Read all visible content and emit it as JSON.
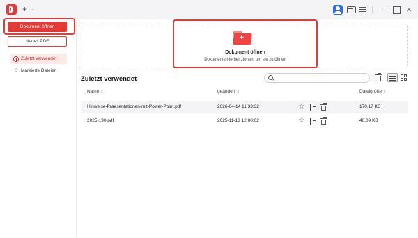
{
  "titlebar": {
    "new_tab_symbol": "+",
    "chevron_symbol": "⌄",
    "close_symbol": "×"
  },
  "sidebar": {
    "open_button": "Dokument öffnen",
    "new_pdf_button": "Neues PDF",
    "items": [
      {
        "label": "Zuletzt verwendet",
        "icon": "clock-icon",
        "active": true
      },
      {
        "label": "Markierte Dateien",
        "icon": "star-icon",
        "active": false
      }
    ]
  },
  "dropzone": {
    "title": "Dokument öffnen",
    "subtitle": "Dokumente hierher ziehen, um sie zu öffnen",
    "plus": "+"
  },
  "recent": {
    "title": "Zuletzt verwendet",
    "search_placeholder": "",
    "columns": {
      "name": "Name",
      "modified": "geändert",
      "size": "Dateigröße"
    },
    "sort_symbol": "⇕",
    "files": [
      {
        "name": "Hinweise-Praesentationen-mit-Power-Point.pdf",
        "modified": "2026-04-14 11:33:32",
        "size": "170.17 KB"
      },
      {
        "name": "2025-190.pdf",
        "modified": "2025-11-13 12:00:02",
        "size": "40.09 KB"
      }
    ]
  },
  "colors": {
    "accent": "#e53935",
    "active_nav_bg": "#fde9e8",
    "user_icon": "#2f6fe0"
  }
}
